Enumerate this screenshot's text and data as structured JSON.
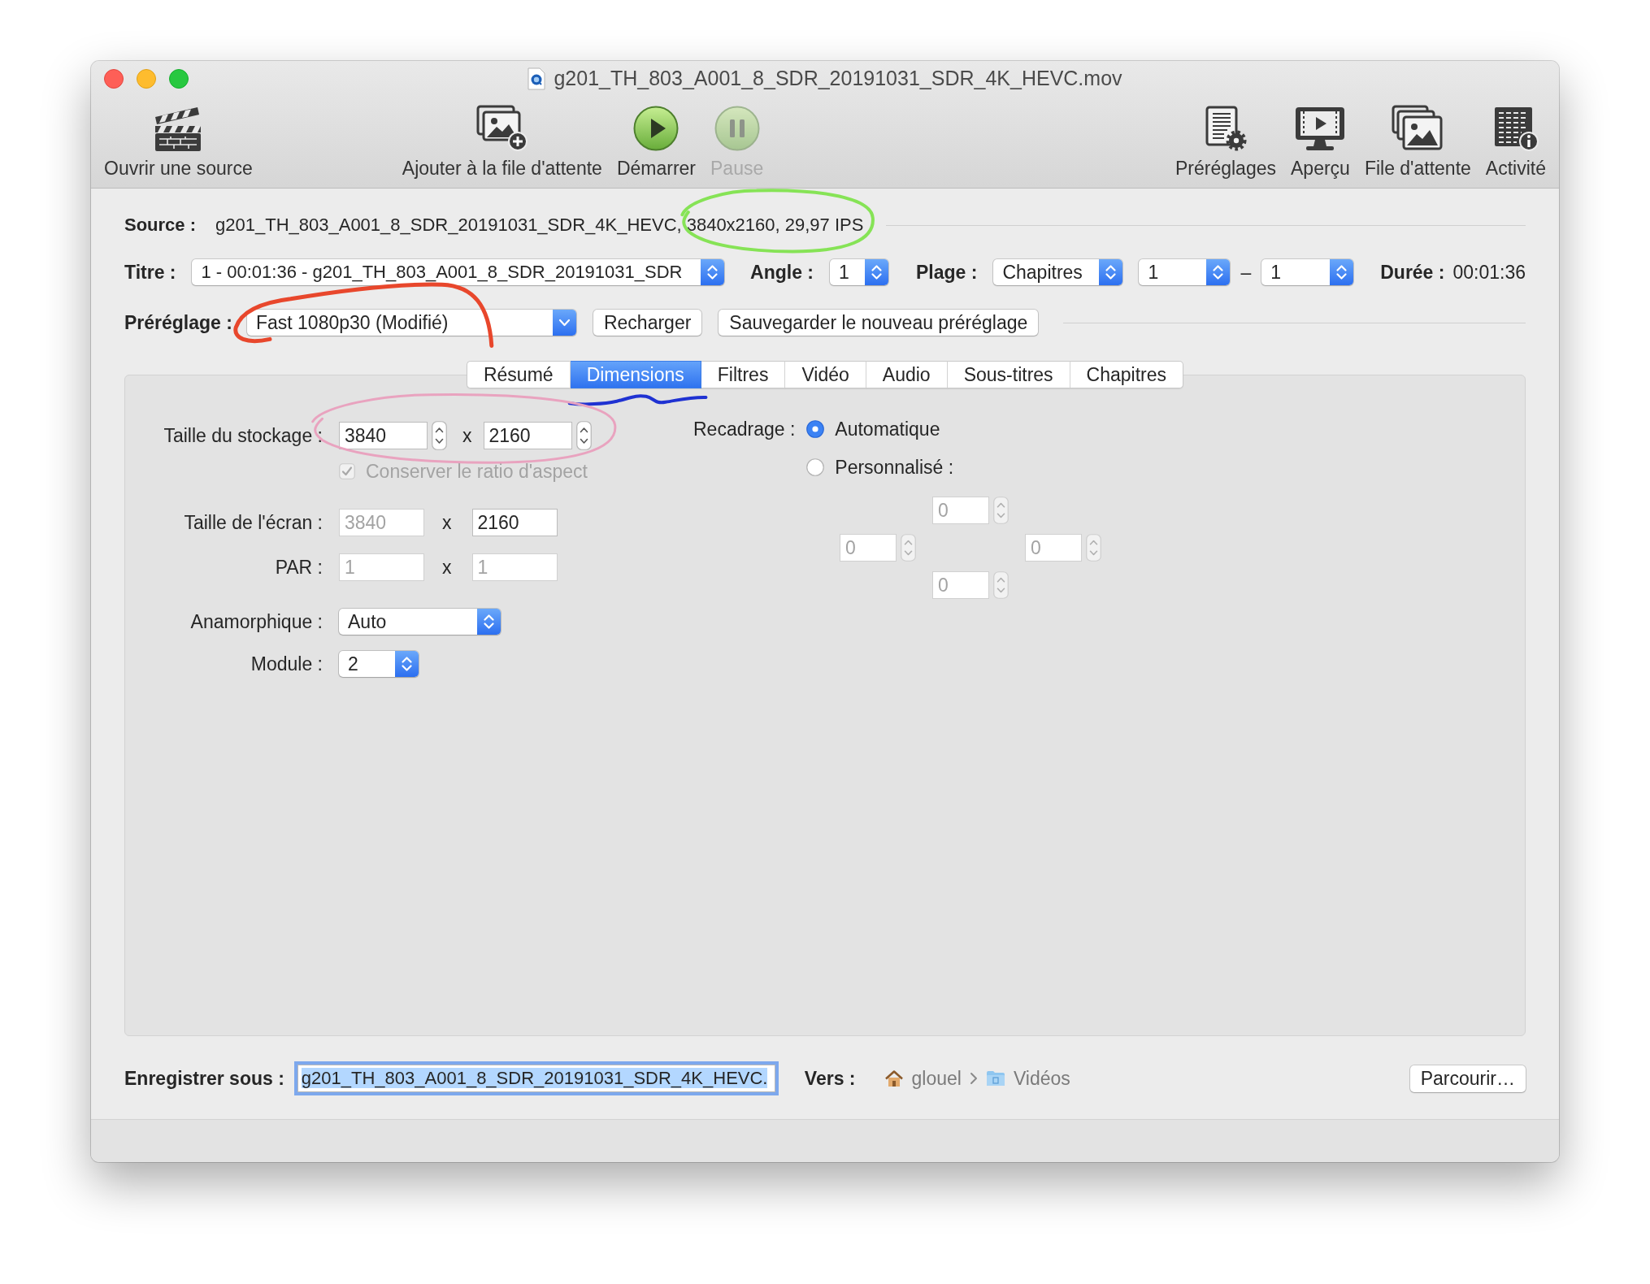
{
  "window": {
    "title": "g201_TH_803_A001_8_SDR_20191031_SDR_4K_HEVC.mov"
  },
  "toolbar": {
    "left": [
      {
        "kind": "open",
        "label": "Ouvrir une source",
        "disabled": false
      }
    ],
    "center": [
      {
        "kind": "add_queue",
        "label": "Ajouter à la file d'attente",
        "disabled": false
      },
      {
        "kind": "start",
        "label": "Démarrer",
        "disabled": false
      },
      {
        "kind": "pause",
        "label": "Pause",
        "disabled": true
      }
    ],
    "right": [
      {
        "kind": "presets",
        "label": "Préréglages",
        "disabled": false
      },
      {
        "kind": "preview",
        "label": "Aperçu",
        "disabled": false
      },
      {
        "kind": "queue",
        "label": "File d'attente",
        "disabled": false
      },
      {
        "kind": "activity",
        "label": "Activité",
        "disabled": false
      }
    ]
  },
  "source": {
    "label": "Source :",
    "file": "g201_TH_803_A001_8_SDR_20191031_SDR_4K_HEVC,",
    "format": {
      "text": "3840x2160, 29,97 IPS",
      "annotation": {
        "kind": "ellipse",
        "color": "#86e356"
      }
    }
  },
  "title_row": {
    "title": {
      "label": "Titre :",
      "value": "1 - 00:01:36 - g201_TH_803_A001_8_SDR_20191031_SDR"
    },
    "angle": {
      "label": "Angle :",
      "value": "1"
    },
    "range": {
      "label": "Plage :",
      "value": "Chapitres",
      "start": "1",
      "separator": "–",
      "end": "1"
    },
    "duration": {
      "label": "Durée :",
      "value": "00:01:36"
    }
  },
  "preset": {
    "label": "Préréglage :",
    "value": "Fast 1080p30 (Modifié)",
    "annotation": {
      "kind": "loop",
      "color": "#e8472c"
    },
    "buttons": [
      "Recharger",
      "Sauvegarder le nouveau préréglage"
    ]
  },
  "tabs": [
    {
      "label": "Résumé",
      "selected": false
    },
    {
      "label": "Dimensions",
      "selected": true,
      "annotation": {
        "kind": "squiggle",
        "color": "#1f32d2"
      }
    },
    {
      "label": "Filtres",
      "selected": false
    },
    {
      "label": "Vidéo",
      "selected": false
    },
    {
      "label": "Audio",
      "selected": false
    },
    {
      "label": "Sous-titres",
      "selected": false
    },
    {
      "label": "Chapitres",
      "selected": false
    }
  ],
  "dimensions": {
    "storage": {
      "label": "Taille du stockage :",
      "width": {
        "value": "3840",
        "disabled": false
      },
      "times": "x",
      "height": {
        "value": "2160",
        "disabled": false
      },
      "annotation": {
        "kind": "ellipse",
        "color": "#e9a3bf"
      }
    },
    "keep_aspect": {
      "label": "Conserver le ratio d'aspect",
      "checked": true,
      "disabled": true
    },
    "display": {
      "label": "Taille de l'écran :",
      "width": {
        "value": "3840",
        "disabled": true
      },
      "times": "x",
      "height": {
        "value": "2160",
        "disabled": false
      }
    },
    "par": {
      "label": "PAR :",
      "width": {
        "value": "1",
        "disabled": true
      },
      "times": "x",
      "height": {
        "value": "1",
        "disabled": true
      }
    },
    "anamorphic": {
      "label": "Anamorphique :",
      "value": "Auto"
    },
    "modulus": {
      "label": "Module :",
      "value": "2"
    },
    "crop": {
      "label": "Recadrage :",
      "options": [
        {
          "label": "Automatique",
          "selected": true
        },
        {
          "label": "Personnalisé :",
          "selected": false
        }
      ],
      "top": {
        "value": "0",
        "disabled": true
      },
      "left": {
        "value": "0",
        "disabled": true
      },
      "right": {
        "value": "0",
        "disabled": true
      },
      "bottom": {
        "value": "0",
        "disabled": true
      }
    }
  },
  "save": {
    "label": "Enregistrer sous :",
    "value": "g201_TH_803_A001_8_SDR_20191031_SDR_4K_HEVC.",
    "text_selected": true,
    "destination": {
      "label": "Vers :",
      "path": [
        {
          "kind": "home",
          "label": "glouel"
        },
        {
          "kind": "folder",
          "label": "Vidéos"
        }
      ]
    },
    "browse": "Parcourir…"
  }
}
